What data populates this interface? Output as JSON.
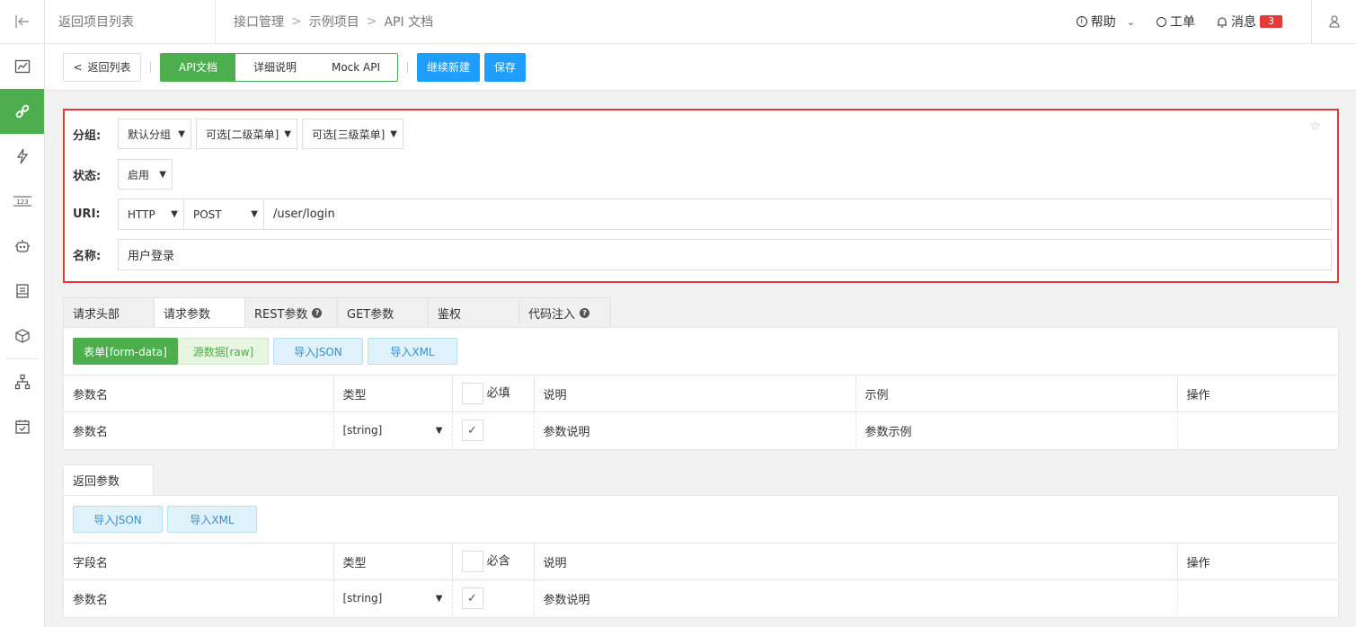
{
  "topbar": {
    "back_project": "返回项目列表",
    "breadcrumb": [
      "接口管理",
      "示例项目",
      "API 文档"
    ],
    "help": "帮助",
    "ticket": "工单",
    "messages": "消息",
    "message_count": "3"
  },
  "sidebar": {
    "items": [
      "dashboard-icon",
      "api-link-icon",
      "flash-icon",
      "number-icon",
      "robot-icon",
      "document-icon",
      "cube-icon",
      "sitemap-icon",
      "calendar-check-icon"
    ],
    "active_index": 1
  },
  "toolbar": {
    "back_list": "返回列表",
    "tab_api_doc": "API文档",
    "tab_detail": "详细说明",
    "tab_mock": "Mock API",
    "continue_new": "继续新建",
    "save": "保存"
  },
  "form": {
    "group_label": "分组:",
    "group_value": "默认分组",
    "group_l2": "可选[二级菜单]",
    "group_l3": "可选[三级菜单]",
    "status_label": "状态:",
    "status_value": "启用",
    "uri_label": "URI:",
    "protocol": "HTTP",
    "method": "POST",
    "uri_value": "/user/login",
    "name_label": "名称:",
    "name_value": "用户登录"
  },
  "request_tabs": [
    "请求头部",
    "请求参数",
    "REST参数",
    "GET参数",
    "鉴权",
    "代码注入"
  ],
  "request_panel": {
    "btn_form": "表单[form-data]",
    "btn_raw": "源数据[raw]",
    "btn_import_json": "导入JSON",
    "btn_import_xml": "导入XML",
    "headers": {
      "name": "参数名",
      "type": "类型",
      "required": "必填",
      "desc": "说明",
      "example": "示例",
      "action": "操作"
    },
    "row": {
      "name_placeholder": "参数名",
      "type": "[string]",
      "desc_placeholder": "参数说明",
      "example_placeholder": "参数示例"
    }
  },
  "response": {
    "tab": "返回参数",
    "btn_import_json": "导入JSON",
    "btn_import_xml": "导入XML",
    "headers": {
      "name": "字段名",
      "type": "类型",
      "contains": "必含",
      "desc": "说明",
      "action": "操作"
    },
    "row": {
      "name_placeholder": "参数名",
      "type": "[string]",
      "desc_placeholder": "参数说明"
    }
  },
  "colors": {
    "green": "#4cae4c",
    "blue": "#1e9fff",
    "highlight_border": "#e53935",
    "badge": "#e53935"
  }
}
